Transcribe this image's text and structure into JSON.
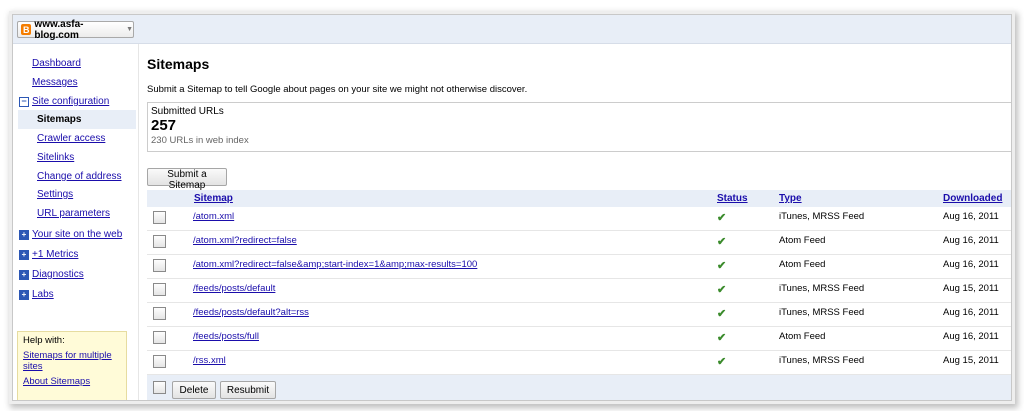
{
  "site": {
    "name": "www.asfa-blog.com"
  },
  "sidebar": {
    "dashboard": "Dashboard",
    "messages": "Messages",
    "site_configuration": "Site configuration",
    "sub": [
      "Sitemaps",
      "Crawler access",
      "Sitelinks",
      "Change of address",
      "Settings",
      "URL parameters"
    ],
    "your_site": "Your site on the web",
    "plus1": "+1 Metrics",
    "diagnostics": "Diagnostics",
    "labs": "Labs",
    "help": {
      "heading": "Help with:",
      "link1": "Sitemaps for multiple sites",
      "link2": "About Sitemaps"
    }
  },
  "main": {
    "title": "Sitemaps",
    "description": "Submit a Sitemap to tell Google about pages on your site we might not otherwise discover.",
    "stats": {
      "label": "Submitted URLs",
      "count": "257",
      "indexed": "230 URLs in web index"
    },
    "submit_label": "Submit a Sitemap",
    "columns": {
      "sitemap": "Sitemap",
      "status": "Status",
      "type": "Type",
      "downloaded": "Downloaded"
    },
    "rows": [
      {
        "sitemap": "/atom.xml",
        "status": "✔",
        "type": "iTunes, MRSS Feed",
        "downloaded": "Aug 16, 2011"
      },
      {
        "sitemap": "/atom.xml?redirect=false",
        "status": "✔",
        "type": "Atom Feed",
        "downloaded": "Aug 16, 2011"
      },
      {
        "sitemap": "/atom.xml?redirect=false&amp;start-index=1&amp;max-results=100",
        "status": "✔",
        "type": "Atom Feed",
        "downloaded": "Aug 16, 2011"
      },
      {
        "sitemap": "/feeds/posts/default",
        "status": "✔",
        "type": "iTunes, MRSS Feed",
        "downloaded": "Aug 15, 2011"
      },
      {
        "sitemap": "/feeds/posts/default?alt=rss",
        "status": "✔",
        "type": "iTunes, MRSS Feed",
        "downloaded": "Aug 16, 2011"
      },
      {
        "sitemap": "/feeds/posts/full",
        "status": "✔",
        "type": "Atom Feed",
        "downloaded": "Aug 16, 2011"
      },
      {
        "sitemap": "/rss.xml",
        "status": "✔",
        "type": "iTunes, MRSS Feed",
        "downloaded": "Aug 15, 2011"
      }
    ],
    "delete_label": "Delete",
    "resubmit_label": "Resubmit"
  },
  "colors": {
    "header_bg": "#e8eef7",
    "link": "#1a0dab",
    "check": "#3b8b2c",
    "help_bg": "#fffbd8"
  }
}
